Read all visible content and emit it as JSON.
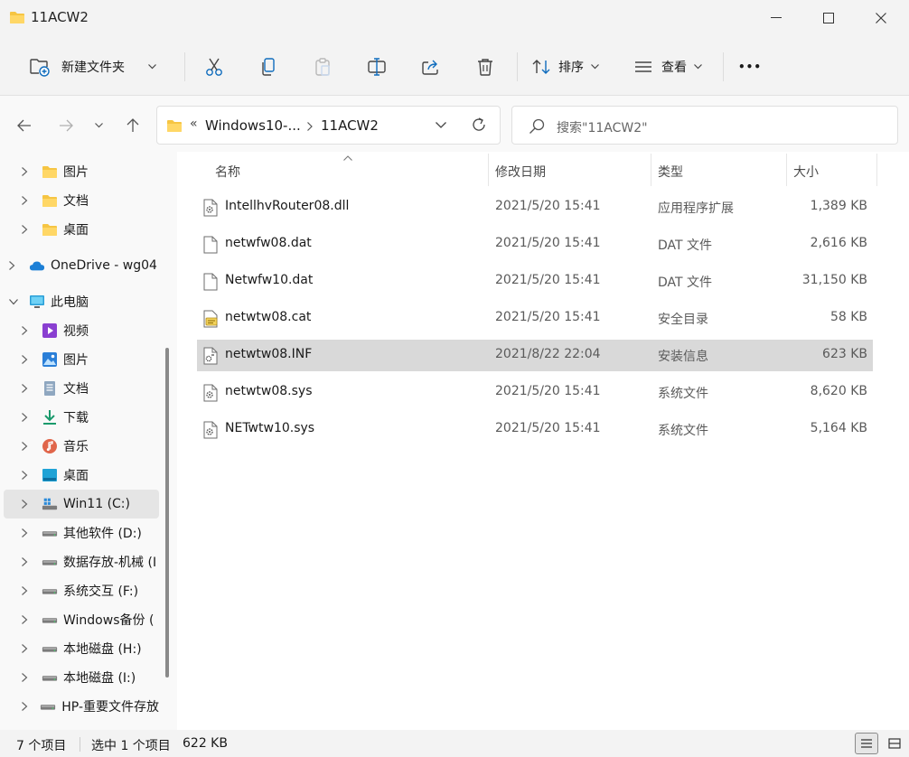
{
  "window": {
    "title": "11ACW2"
  },
  "toolbar": {
    "new_folder_label": "新建文件夹",
    "sort_label": "排序",
    "view_label": "查看",
    "more_label": "•••"
  },
  "address": {
    "ellipsis": "«",
    "segments": [
      "Windows10-...",
      "11ACW2"
    ]
  },
  "search": {
    "placeholder": "搜索\"11ACW2\""
  },
  "columns": {
    "name": "名称",
    "date": "修改日期",
    "type": "类型",
    "size": "大小"
  },
  "sidebar": {
    "items": [
      {
        "label": "图片",
        "icon": "folder-icon"
      },
      {
        "label": "文档",
        "icon": "folder-icon"
      },
      {
        "label": "桌面",
        "icon": "folder-icon"
      },
      {
        "label": "OneDrive - wg04",
        "icon": "cloud-icon"
      },
      {
        "label": "此电脑",
        "icon": "pc-icon"
      },
      {
        "label": "视频",
        "icon": "video-icon"
      },
      {
        "label": "图片",
        "icon": "pictures-icon"
      },
      {
        "label": "文档",
        "icon": "documents-icon"
      },
      {
        "label": "下载",
        "icon": "download-icon"
      },
      {
        "label": "音乐",
        "icon": "music-icon"
      },
      {
        "label": "桌面",
        "icon": "desktop-icon"
      },
      {
        "label": "Win11 (C:)",
        "icon": "windows-drive-icon"
      },
      {
        "label": "其他软件 (D:)",
        "icon": "drive-icon"
      },
      {
        "label": "数据存放-机械 (I",
        "icon": "drive-icon"
      },
      {
        "label": "系统交互 (F:)",
        "icon": "drive-icon"
      },
      {
        "label": "Windows备份 (",
        "icon": "drive-icon"
      },
      {
        "label": "本地磁盘 (H:)",
        "icon": "drive-icon"
      },
      {
        "label": "本地磁盘 (I:)",
        "icon": "drive-icon"
      },
      {
        "label": "HP-重要文件存放",
        "icon": "drive-icon"
      }
    ]
  },
  "files": [
    {
      "name": "IntellhvRouter08.dll",
      "date": "2021/5/20 15:41",
      "type": "应用程序扩展",
      "size": "1,389 KB",
      "icon": "dll-file-icon"
    },
    {
      "name": "netwfw08.dat",
      "date": "2021/5/20 15:41",
      "type": "DAT 文件",
      "size": "2,616 KB",
      "icon": "blank-file-icon"
    },
    {
      "name": "Netwfw10.dat",
      "date": "2021/5/20 15:41",
      "type": "DAT 文件",
      "size": "31,150 KB",
      "icon": "blank-file-icon"
    },
    {
      "name": "netwtw08.cat",
      "date": "2021/5/20 15:41",
      "type": "安全目录",
      "size": "58 KB",
      "icon": "catalog-file-icon"
    },
    {
      "name": "netwtw08.INF",
      "date": "2021/8/22 22:04",
      "type": "安装信息",
      "size": "623 KB",
      "icon": "inf-file-icon"
    },
    {
      "name": "netwtw08.sys",
      "date": "2021/5/20 15:41",
      "type": "系统文件",
      "size": "8,620 KB",
      "icon": "sys-file-icon"
    },
    {
      "name": "NETwtw10.sys",
      "date": "2021/5/20 15:41",
      "type": "系统文件",
      "size": "5,164 KB",
      "icon": "sys-file-icon"
    }
  ],
  "status": {
    "count": "7 个项目",
    "selection": "选中 1 个项目",
    "selection_size": "622 KB"
  },
  "colors": {
    "folder_yellow": "#f6c543",
    "selection_gray": "#d9d9d9",
    "accent_blue": "#0f6cbd"
  }
}
